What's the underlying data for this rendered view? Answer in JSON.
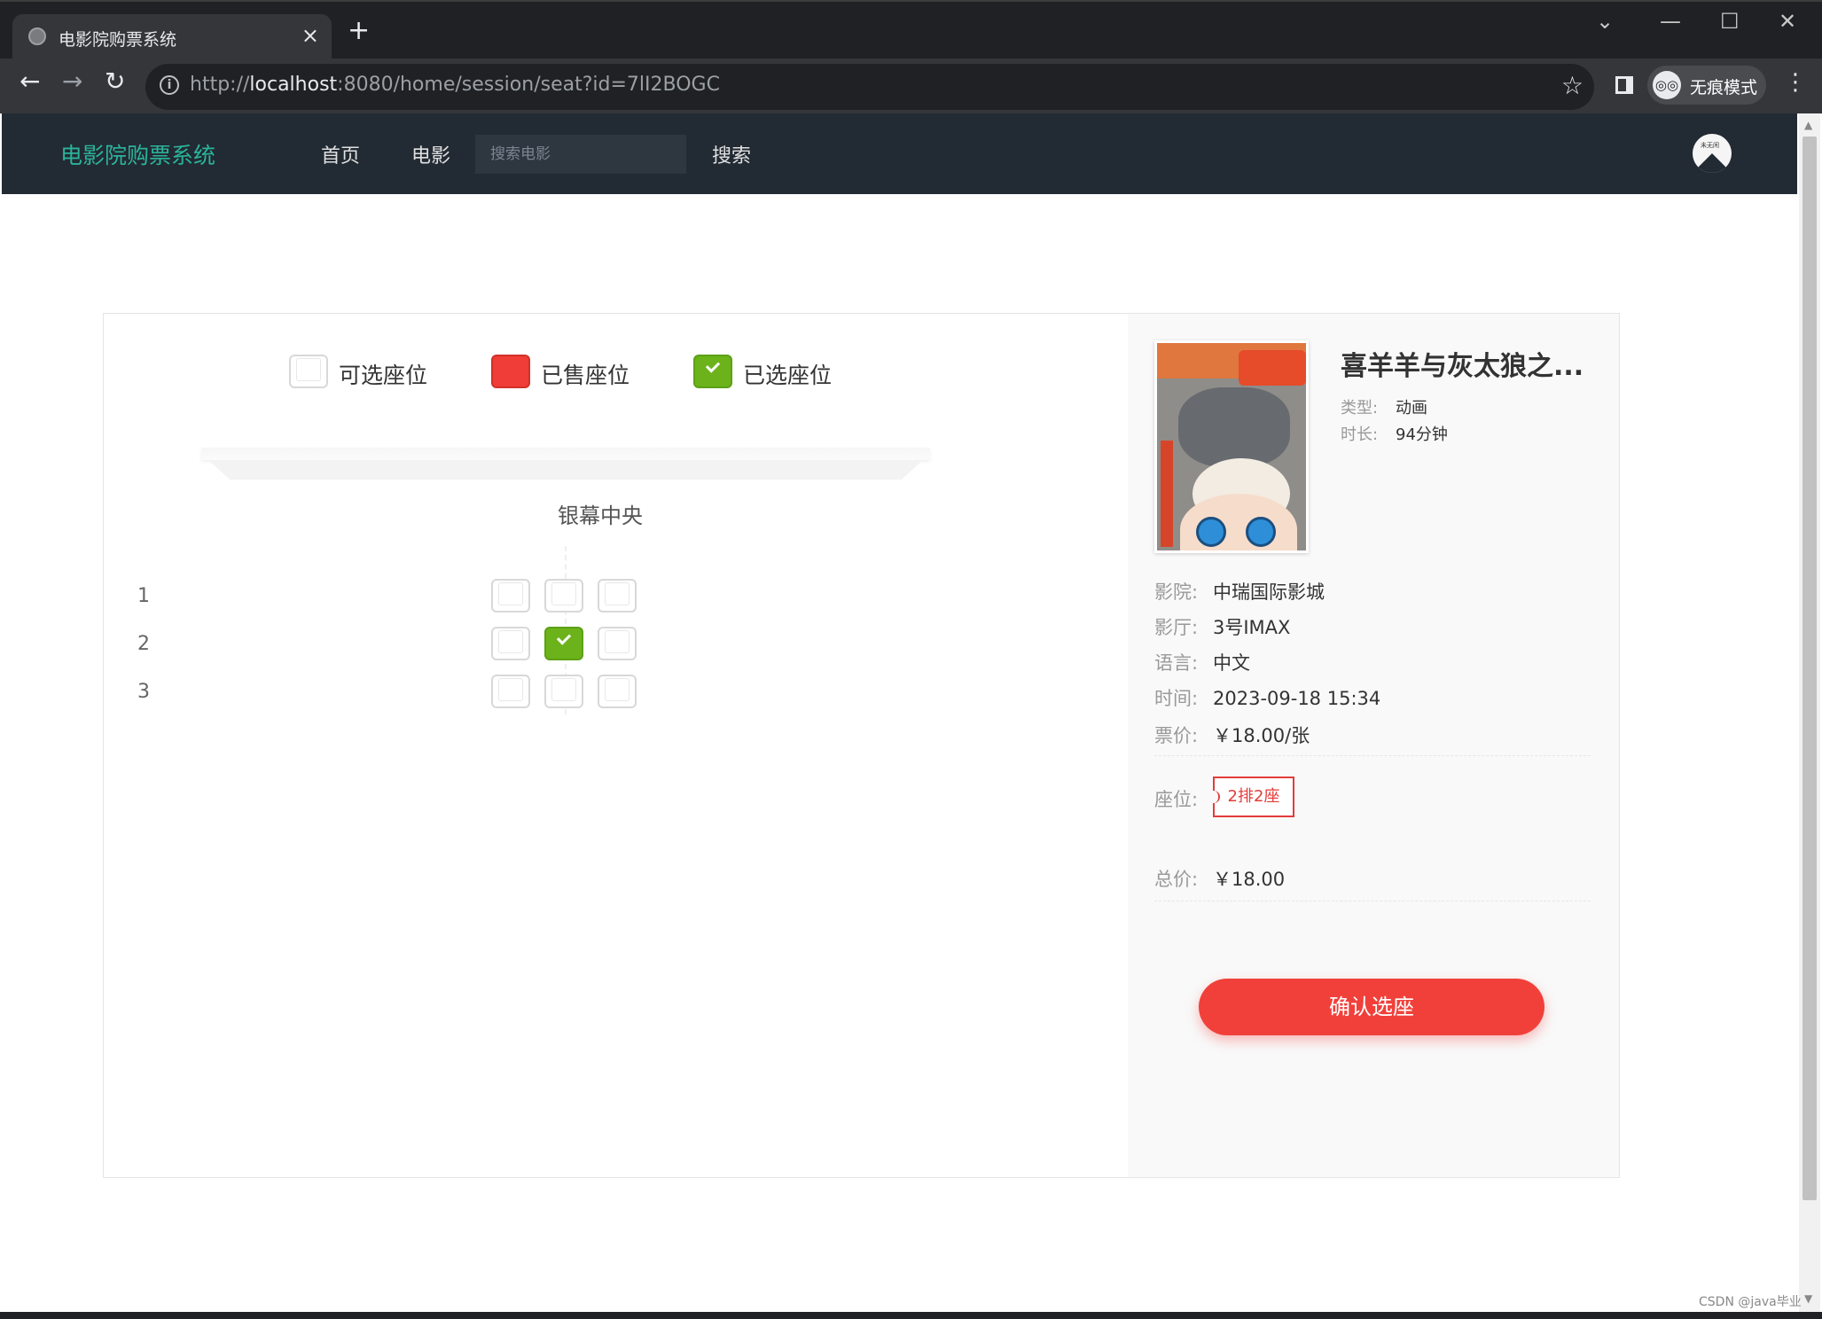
{
  "browser": {
    "tab_title": "电影院购票系统",
    "url_scheme": "http://",
    "url_host": "localhost",
    "url_rest": ":8080/home/session/seat?id=7lI2BOGC",
    "profile_label": "无痕模式"
  },
  "header": {
    "brand": "电影院购票系统",
    "nav": [
      "首页",
      "电影"
    ],
    "search_placeholder": "搜索电影",
    "search_button": "搜索",
    "avatar_text": "未无闲"
  },
  "legend": {
    "available": "可选座位",
    "sold": "已售座位",
    "selected": "已选座位"
  },
  "screen_label": "银幕中央",
  "rows": [
    {
      "num": "1",
      "seats": [
        "free",
        "free",
        "free"
      ]
    },
    {
      "num": "2",
      "seats": [
        "free",
        "selected",
        "free"
      ]
    },
    {
      "num": "3",
      "seats": [
        "free",
        "free",
        "free"
      ]
    }
  ],
  "movie": {
    "title": "喜羊羊与灰太狼之...",
    "genre_label": "类型:",
    "genre": "动画",
    "duration_label": "时长:",
    "duration": "94分钟"
  },
  "session": {
    "cinema_label": "影院:",
    "cinema": "中瑞国际影城",
    "hall_label": "影厅:",
    "hall": "3号IMAX",
    "language_label": "语言:",
    "language": "中文",
    "time_label": "时间:",
    "time": "2023-09-18 15:34",
    "price_label": "票价:",
    "price": "￥18.00/张",
    "seat_label": "座位:",
    "selected_seat": "2排2座",
    "total_label": "总价:",
    "total": "￥18.00"
  },
  "confirm_button": "确认选座",
  "watermark": "CSDN @java毕业",
  "colors": {
    "brand": "#2bb39a",
    "sold": "#f03d37",
    "selected": "#6cb31b",
    "accent": "#f1403a"
  }
}
